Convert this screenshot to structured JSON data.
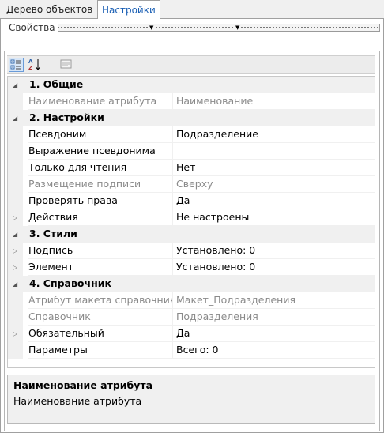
{
  "tabs": [
    {
      "label": "Дерево объектов",
      "active": false
    },
    {
      "label": "Настройки",
      "active": true
    }
  ],
  "group": {
    "title": "Свойства"
  },
  "toolbar": {
    "buttons": [
      "categorized-icon",
      "alphabetical-icon",
      "property-pages-icon"
    ]
  },
  "grid": {
    "rows": [
      {
        "type": "category",
        "label": "1. Общие"
      },
      {
        "type": "prop",
        "name": "Наименование атрибута",
        "value": "Наименование",
        "disabled": true,
        "expandable": false
      },
      {
        "type": "category",
        "label": "2. Настройки"
      },
      {
        "type": "prop",
        "name": "Псевдоним",
        "value": "Подразделение",
        "disabled": false,
        "expandable": false
      },
      {
        "type": "prop",
        "name": "Выражение псевдонима",
        "value": "",
        "disabled": false,
        "expandable": false
      },
      {
        "type": "prop",
        "name": "Только для чтения",
        "value": "Нет",
        "disabled": false,
        "expandable": false
      },
      {
        "type": "prop",
        "name": "Размещение подписи",
        "value": "Сверху",
        "disabled": true,
        "expandable": false
      },
      {
        "type": "prop",
        "name": "Проверять права",
        "value": "Да",
        "disabled": false,
        "expandable": false
      },
      {
        "type": "prop",
        "name": "Действия",
        "value": "Не настроены",
        "disabled": false,
        "expandable": true
      },
      {
        "type": "category",
        "label": "3. Стили"
      },
      {
        "type": "prop",
        "name": "Подпись",
        "value": "Установлено: 0",
        "disabled": false,
        "expandable": true
      },
      {
        "type": "prop",
        "name": "Элемент",
        "value": "Установлено: 0",
        "disabled": false,
        "expandable": true
      },
      {
        "type": "category",
        "label": "4. Справочник"
      },
      {
        "type": "prop",
        "name": "Атрибут макета справочника",
        "value": "Макет_Подразделения",
        "disabled": true,
        "expandable": false
      },
      {
        "type": "prop",
        "name": "Справочник",
        "value": "Подразделения",
        "disabled": true,
        "expandable": false
      },
      {
        "type": "prop",
        "name": "Обязательный",
        "value": "Да",
        "disabled": false,
        "expandable": true
      },
      {
        "type": "prop",
        "name": "Параметры",
        "value": "Всего: 0",
        "disabled": false,
        "expandable": false
      }
    ]
  },
  "help": {
    "title": "Наименование атрибута",
    "description": "Наименование атрибута"
  }
}
